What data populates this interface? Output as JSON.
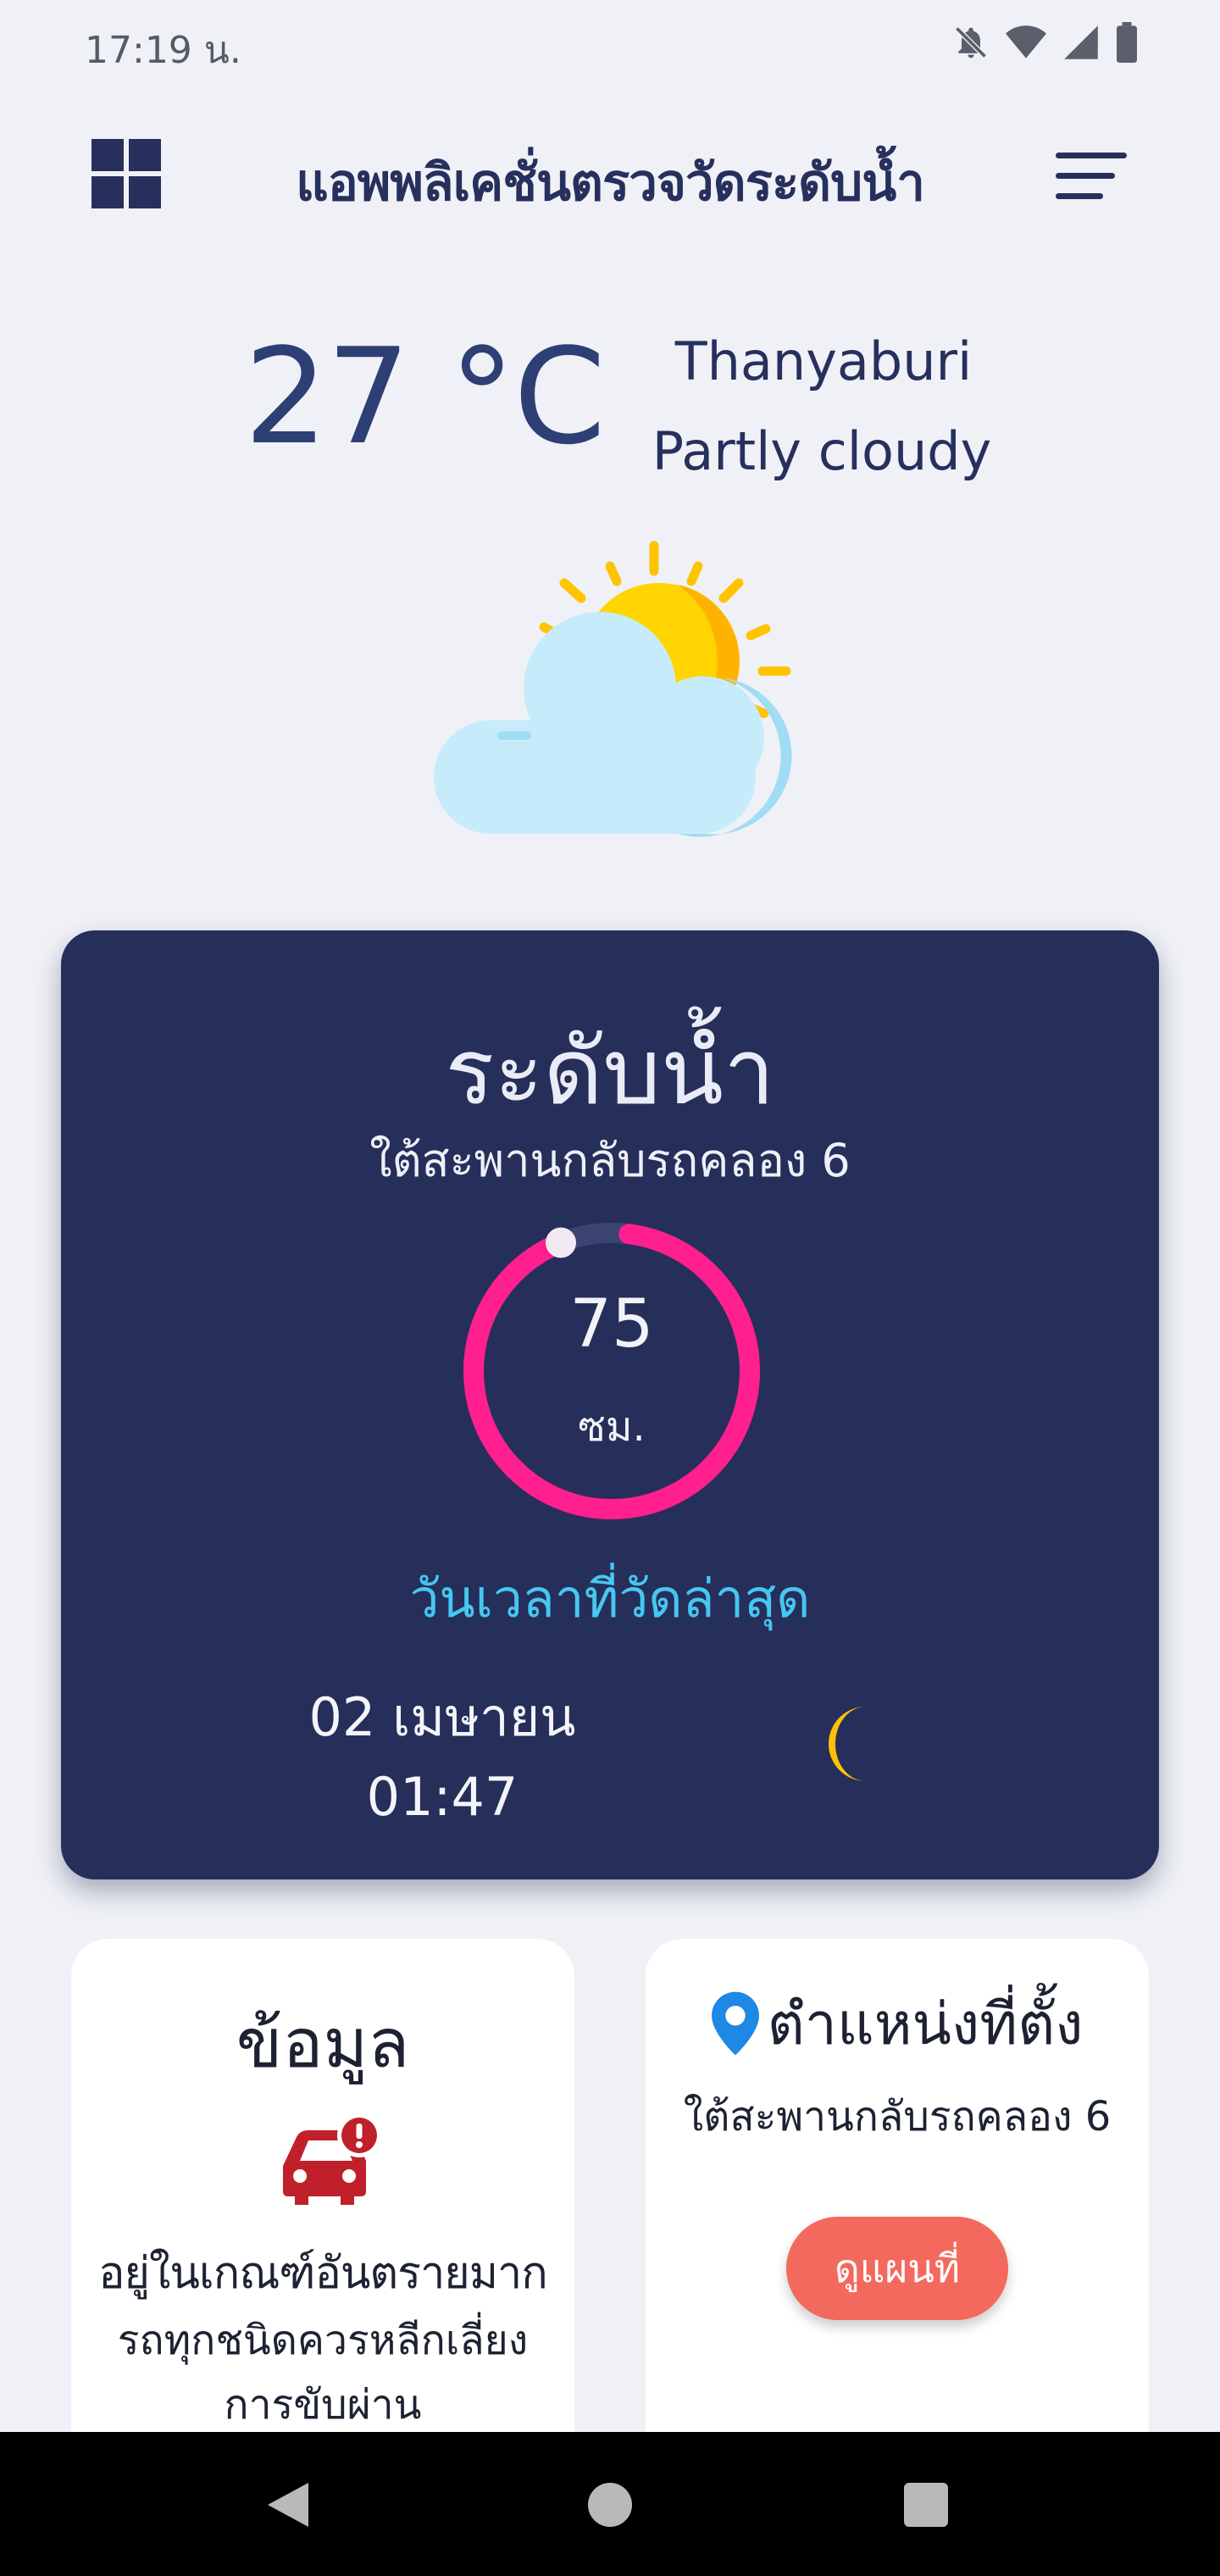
{
  "status_bar": {
    "time": "17:19 น.",
    "icons": [
      "bell-off-icon",
      "wifi-icon",
      "signal-icon",
      "battery-icon"
    ]
  },
  "header": {
    "title": "แอพพลิเคชั่นตรวจวัดระดับน้ำ",
    "left_icon": "grid-menu-icon",
    "right_icon": "hamburger-menu-icon"
  },
  "weather": {
    "temperature": "27 °C",
    "city": "Thanyaburi",
    "condition": "Partly cloudy",
    "icon": "partly-cloudy-icon"
  },
  "water_level": {
    "title": "ระดับน้ำ",
    "location": "ใต้สะพานกลับรถคลอง 6",
    "value": "75",
    "unit": "ซม.",
    "gauge_fraction": 0.92,
    "last_measured_label": "วันเวลาที่วัดล่าสุด",
    "date": "02 เมษายน",
    "time": "01:47",
    "time_icon": "moon-icon"
  },
  "info": {
    "title": "ข้อมูล",
    "icon": "car-alert-icon",
    "status": "อยู่ในเกณฑ์อันตรายมาก",
    "advice_line1": "รถทุกชนิดควรหลีกเลี่ยง",
    "advice_line2": "การขับผ่าน"
  },
  "location_card": {
    "title": "ตำแหน่งที่ตั้ง",
    "icon": "map-pin-icon",
    "text": "ใต้สะพานกลับรถคลอง 6",
    "button_label": "ดูแผนที่"
  },
  "colors": {
    "background": "#eff1f6",
    "card": "#262e5a",
    "gauge": "#ff1f8e",
    "accent_text": "#45c7f0",
    "button": "#f4695d",
    "danger": "#c0202a",
    "pin": "#1e88e5"
  }
}
